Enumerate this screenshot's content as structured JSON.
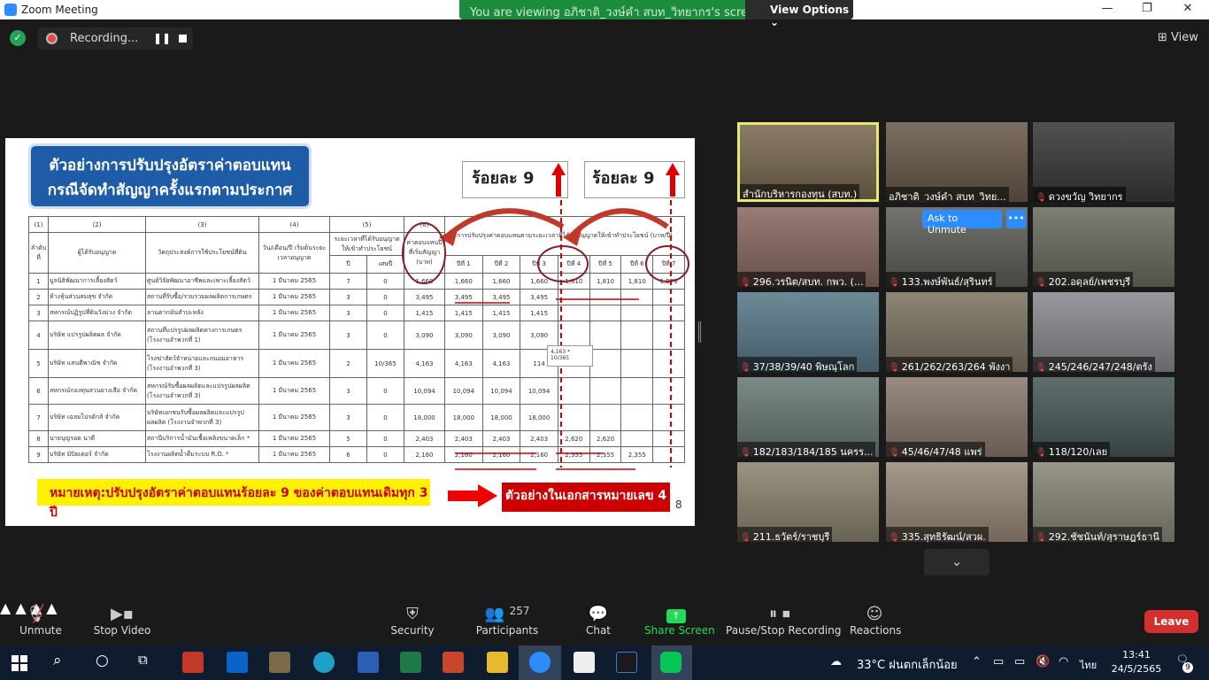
{
  "window": {
    "title": "Zoom Meeting"
  },
  "banner": {
    "viewing_text": "You are viewing อภิชาติ_วงษ์คำ สบท_วิทยากร's screen",
    "view_options": "View Options ⌄"
  },
  "recording": {
    "label": "Recording...",
    "pause_icon": "❚❚"
  },
  "view_button": {
    "label": "View"
  },
  "slide": {
    "title_line1": "ตัวอย่างการปรับปรุงอัตราค่าตอบแทน",
    "title_line2": "กรณีจัดทำสัญญาครั้งแรกตามประกาศ",
    "percent_label_1": "ร้อยละ 9",
    "percent_label_2": "ร้อยละ 9",
    "table": {
      "col_numbers": [
        "(1)",
        "(2)",
        "(3)",
        "(4)",
        "(5)",
        "(6)"
      ],
      "headers": {
        "seq": "ลำดับที่",
        "licensee": "ผู้ได้รับอนุญาต",
        "purpose": "วัตถุประสงค์การใช้ประโยชน์ที่ดิน",
        "start_date": "วัน/เดือน/ปี เริ่มต้นระยะเวลาอนุญาต",
        "period": "ระยะเวลาที่ได้รับอนุญาตให้เข้าทำประโยชน์",
        "period_years": "ปี",
        "period_fraction": "เศษปี",
        "fee": "ค่าตอบแทนปีที่เริ่มสัญญา (บาท)",
        "adjust": "การปรับปรุงค่าตอบแทนตามระยะเวลาที่ได้รับอนุญาตให้เข้าทำประโยชน์ (บาท/ปี)",
        "years": [
          "ปีที่ 1",
          "ปีที่ 2",
          "ปีที่ 3",
          "ปีที่ 4",
          "ปีที่ 5",
          "ปีที่ 6",
          "ปีที่ 7"
        ]
      },
      "rows": [
        [
          "1",
          "มูลนิธิพัฒนาการเลี้ยงสัตว์",
          "ศูนย์วิจัยพัฒนาอาชีพและเพาะเลี้ยงสัตว์",
          "1 มีนาคม 2565",
          "7",
          "0",
          "1,660",
          "1,660",
          "1,660",
          "1,660",
          "1,810",
          "1,810",
          "1,810",
          "1,973"
        ],
        [
          "2",
          "ห้างหุ้นส่วนสมสุข จำกัด",
          "สถานที่รับซื้อ/รวบรวมผลผลิตการเกษตร",
          "1 มีนาคม 2565",
          "3",
          "0",
          "3,495",
          "3,495",
          "3,495",
          "3,495",
          "",
          "",
          "",
          ""
        ],
        [
          "3",
          "สหกรณ์ปฏิรูปที่ดินวังม่วง จำกัด",
          "ลานตากมันสำปะหลัง",
          "1 มีนาคม 2565",
          "3",
          "0",
          "1,415",
          "1,415",
          "1,415",
          "1,415",
          "",
          "",
          "",
          ""
        ],
        [
          "4",
          "บริษัท แปรรูปผลิตผล จำกัด",
          "สถานที่แปรรูปผลผลิตทางการเกษตร (โรงงานจำพวกที่ 1)",
          "1 มีนาคม 2565",
          "3",
          "0",
          "3,090",
          "3,090",
          "3,090",
          "3,090",
          "",
          "",
          "",
          ""
        ],
        [
          "5",
          "บริษัท แสนดีพาณิช จำกัด",
          "โรงฆ่าสัตว์จำหน่ายและถนอมอาหาร (โรงงานจำพวกที่ 3)",
          "1 มีนาคม 2565",
          "2",
          "10/365",
          "4,163",
          "4,163",
          "4,163",
          "114",
          "",
          "",
          "",
          ""
        ],
        [
          "6",
          "สหกรณ์กองทุนสวนยางเสือ จำกัด",
          "สหกรณ์รับซื้อผลผลิตและแปรรูปผลผลิต (โรงงานจำพวกที่ 3)",
          "1 มีนาคม 2565",
          "3",
          "0",
          "10,094",
          "10,094",
          "10,094",
          "10,094",
          "",
          "",
          "",
          ""
        ],
        [
          "7",
          "บริษัท เฉลยโปรดักส์ จำกัด",
          "บริษัทเอกชนรับซื้อผลผลิตและแปรรูปผลผลิต (โรงงานจำพวกที่ 3)",
          "1 มีนาคม 2565",
          "3",
          "0",
          "18,000",
          "18,000",
          "18,000",
          "18,000",
          "",
          "",
          "",
          ""
        ],
        [
          "8",
          "นายบุญรอด นาดี",
          "สถานีบริการน้ำมันเชื้อเพลิงขนาดเล็ก *",
          "1 มีนาคม 2565",
          "5",
          "0",
          "2,403",
          "2,403",
          "2,403",
          "2,403",
          "2,620",
          "2,620",
          "",
          ""
        ],
        [
          "9",
          "บริษัท มิปิยเตอร์ จำกัด",
          "โรงงานผลิตน้ำดื่มระบบ R.O. *",
          "1 มีนาคม 2565",
          "6",
          "0",
          "2,160",
          "2,160",
          "2,160",
          "2,160",
          "2,355",
          "2,355",
          "2,355",
          ""
        ]
      ]
    },
    "callout": "4,163 * 10/365",
    "note": "หมายเหตุ:ปรับปรุงอัตราค่าตอบแทนร้อยละ 9 ของค่าตอบแทนเดิมทุก 3 ปี",
    "reference": "ตัวอย่างในเอกสารหมายเลข 4",
    "page_number": "8"
  },
  "participants": [
    {
      "name": "สำนักบริหารกองทุน (สบท.)",
      "muted": false,
      "active": true,
      "bg": "#7a6a52"
    },
    {
      "name": "อภิชาติ_วงษ์คำ สบท_วิทย...",
      "muted": false,
      "active": false,
      "bg": "#6a5a4a"
    },
    {
      "name": "ดวงขวัญ วิทยากร",
      "muted": true,
      "active": false,
      "bg": "#3a3a3a"
    },
    {
      "name": "296.วรนิต/สบท. กพว. (...",
      "muted": true,
      "active": false,
      "bg": "#8a6a62"
    },
    {
      "name": "133.พงษ์พันธ์/สุรินทร์",
      "muted": true,
      "active": false,
      "bg": "#5e6058"
    },
    {
      "name": "202.อดุลย์/เพชรบุรี",
      "muted": true,
      "active": false,
      "bg": "#6a6e60"
    },
    {
      "name": "37/38/39/40 พิษณุโลก",
      "muted": true,
      "active": false,
      "bg": "#5a7a8a"
    },
    {
      "name": "261/262/263/264 พังงา",
      "muted": true,
      "active": false,
      "bg": "#7e7462"
    },
    {
      "name": "245/246/247/248/ตรัง",
      "muted": true,
      "active": false,
      "bg": "#8a8a90"
    },
    {
      "name": "182/183/184/185 นครร...",
      "muted": true,
      "active": false,
      "bg": "#6a7a76"
    },
    {
      "name": "45/46/47/48 แพร่",
      "muted": true,
      "active": false,
      "bg": "#8a7a6e"
    },
    {
      "name": "118/120/เลย",
      "muted": true,
      "active": false,
      "bg": "#4a5a5a"
    },
    {
      "name": "211.ธวัตร์/ราชบุรี",
      "muted": true,
      "active": false,
      "bg": "#8a8470"
    },
    {
      "name": "335.สุทธิรัฒน์/สวผ.",
      "muted": true,
      "active": false,
      "bg": "#9a8a7a"
    },
    {
      "name": "292.ชัชนันท์/สุราษฎร์ธานี",
      "muted": true,
      "active": false,
      "bg": "#8a8878"
    }
  ],
  "ask_to_unmute": "Ask to Unmute",
  "more_dots": "•••",
  "more_tiles_icon": "⌄",
  "toolbar": {
    "unmute": "Unmute",
    "stop_video": "Stop Video",
    "security": "Security",
    "participants": "Participants",
    "participant_count": "257",
    "chat": "Chat",
    "share_screen": "Share Screen",
    "recording": "Pause/Stop Recording",
    "reactions": "Reactions",
    "leave": "Leave"
  },
  "taskbar": {
    "weather": "33°C ฝนตกเล็กน้อย",
    "language": "ไทย",
    "time": "13:41",
    "date": "24/5/2565",
    "notifications": "9"
  },
  "colors": {
    "zoom_blue": "#2d8cff",
    "share_green": "#23d959",
    "leave_red": "#d32f2f",
    "recording_red": "#e44444"
  }
}
